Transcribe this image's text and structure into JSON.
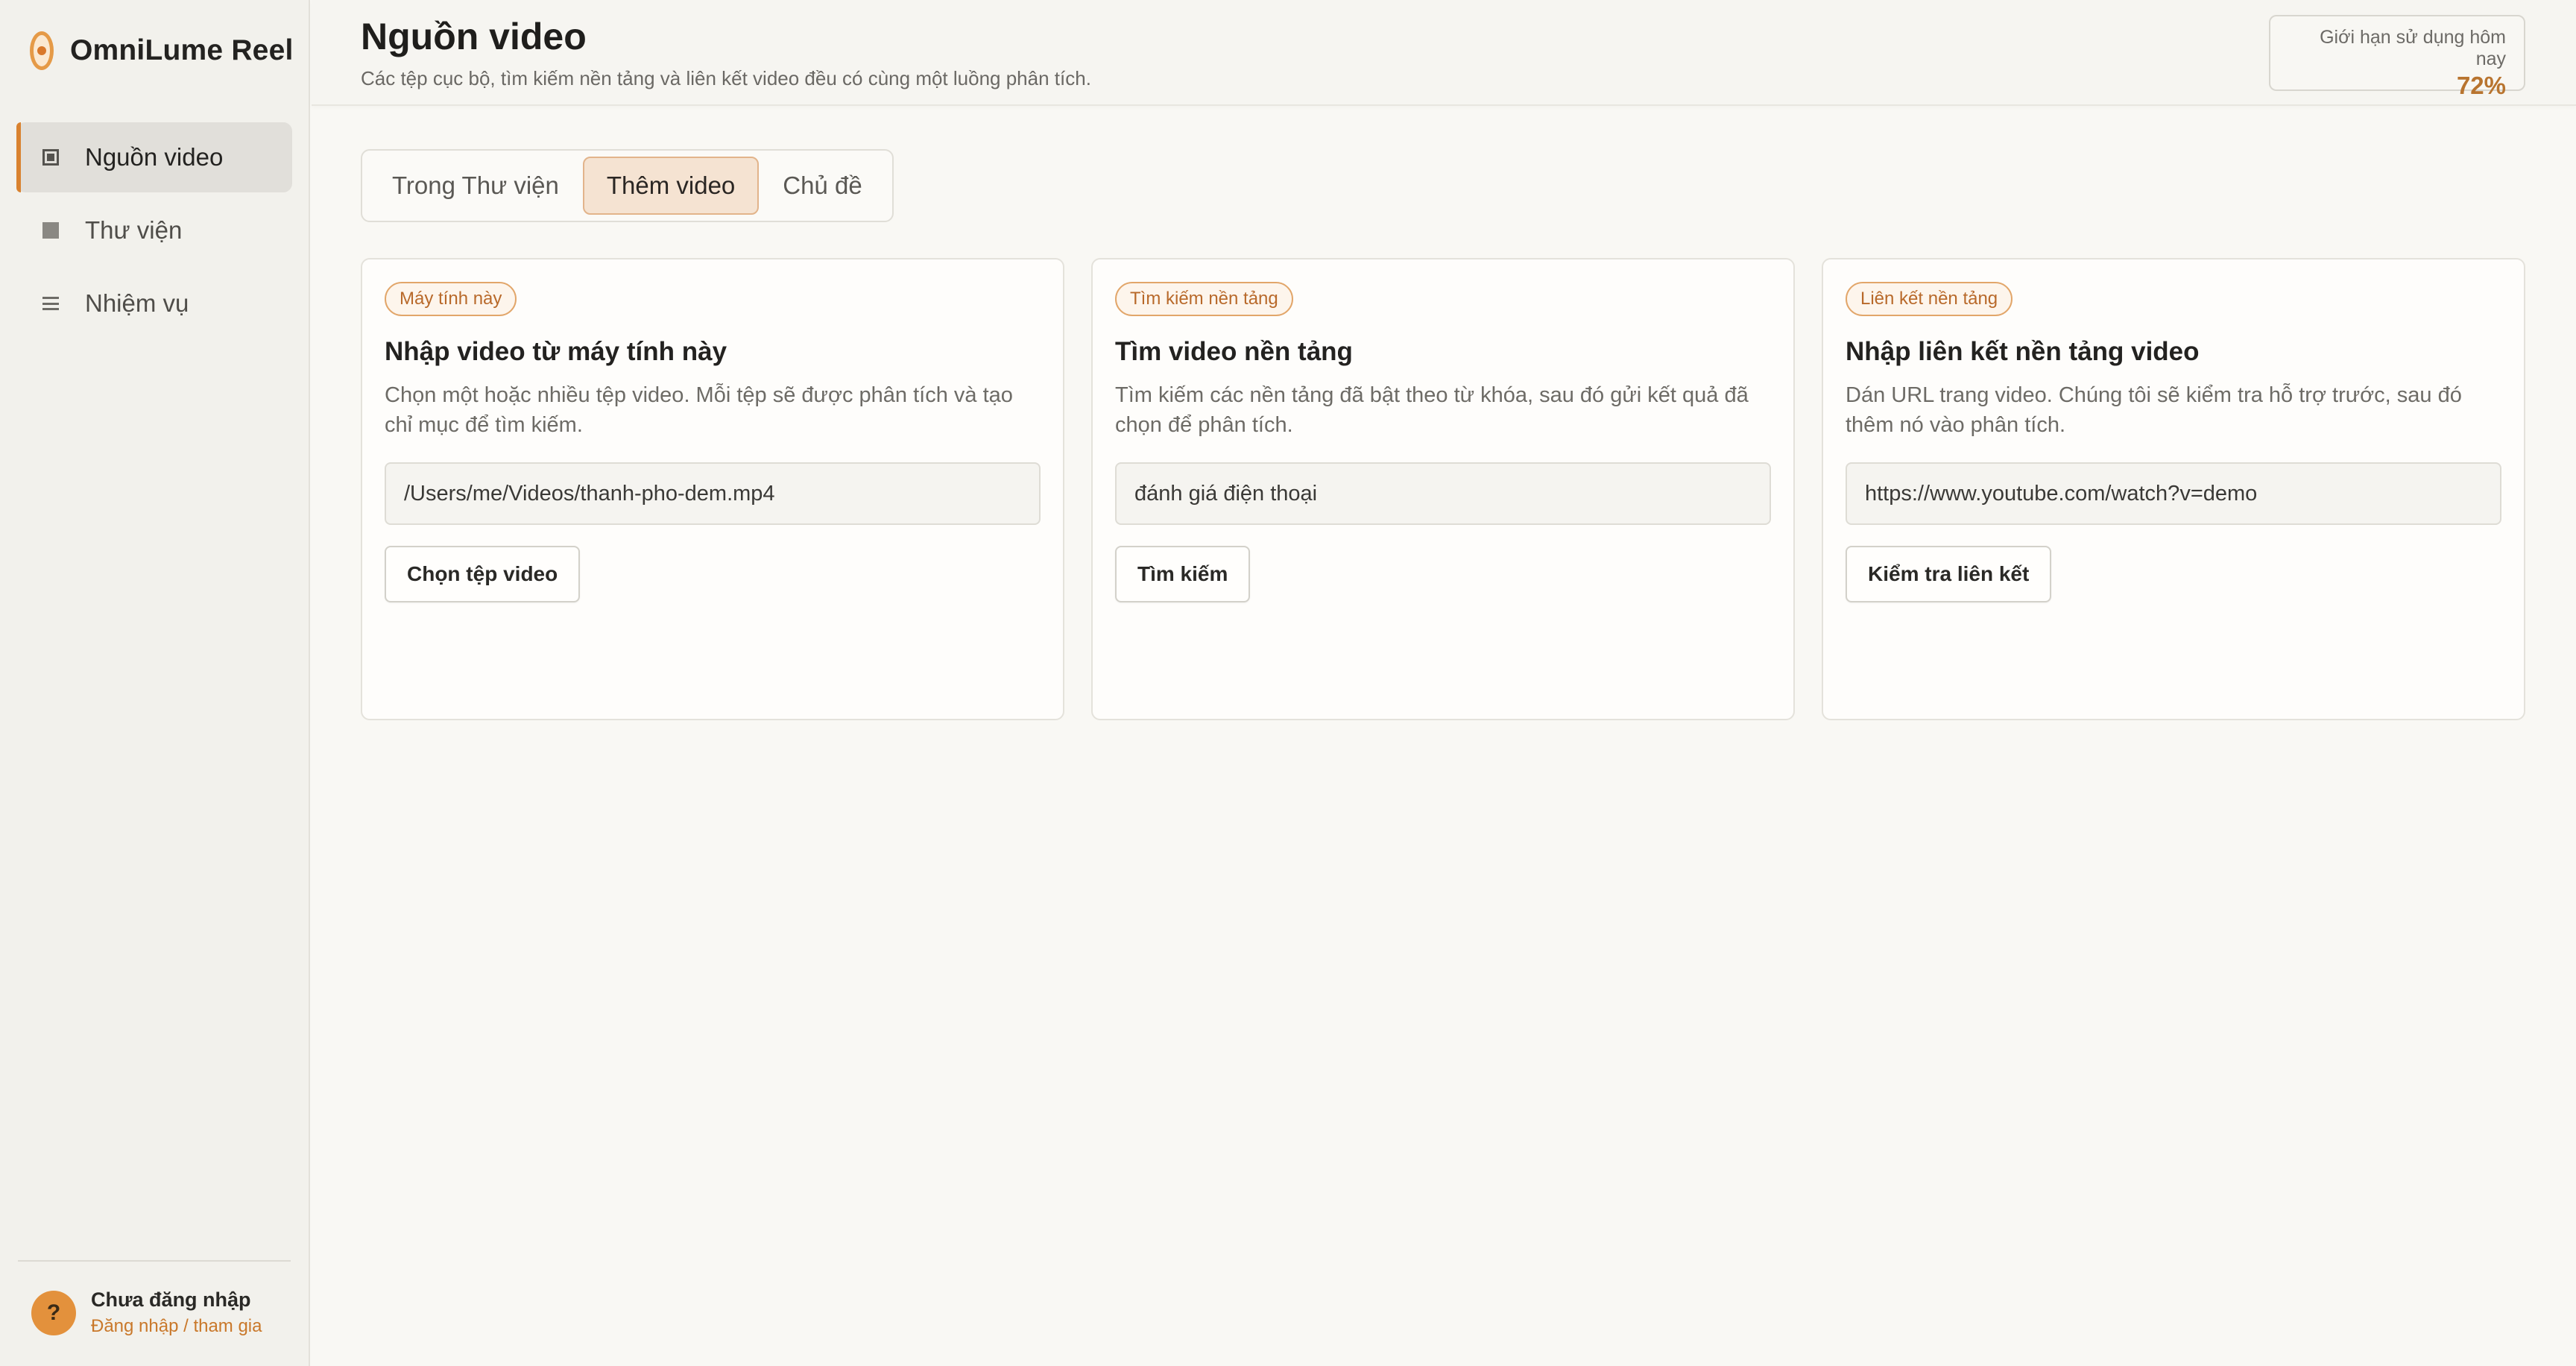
{
  "app": {
    "name": "OmniLume Reel",
    "accent_color": "#d9822f"
  },
  "sidebar": {
    "items": [
      {
        "label": "Nguồn video",
        "icon": "source-icon",
        "active": true
      },
      {
        "label": "Thư viện",
        "icon": "library-icon",
        "active": false
      },
      {
        "label": "Nhiệm vụ",
        "icon": "tasks-icon",
        "active": false
      }
    ],
    "account": {
      "avatar_glyph": "?",
      "title": "Chưa đăng nhập",
      "link": "Đăng nhập / tham gia"
    }
  },
  "header": {
    "title": "Nguồn video",
    "subtitle": "Các tệp cục bộ, tìm kiếm nền tảng và liên kết video đều có cùng một luồng phân tích.",
    "usage_label": "Giới hạn sử dụng hôm nay",
    "usage_value": "72%"
  },
  "tabs": [
    {
      "label": "Trong Thư viện",
      "active": false
    },
    {
      "label": "Thêm video",
      "active": true
    },
    {
      "label": "Chủ đề",
      "active": false
    }
  ],
  "cards": [
    {
      "badge": "Máy tính này",
      "title": "Nhập video từ máy tính này",
      "description": "Chọn một hoặc nhiều tệp video. Mỗi tệp sẽ được phân tích và tạo chỉ mục để tìm kiếm.",
      "input_value": "/Users/me/Videos/thanh-pho-dem.mp4",
      "button": "Chọn tệp video"
    },
    {
      "badge": "Tìm kiếm nền tảng",
      "title": "Tìm video nền tảng",
      "description": "Tìm kiếm các nền tảng đã bật theo từ khóa, sau đó gửi kết quả đã chọn để phân tích.",
      "input_value": "đánh giá điện thoại",
      "button": "Tìm kiếm"
    },
    {
      "badge": "Liên kết nền tảng",
      "title": "Nhập liên kết nền tảng video",
      "description": "Dán URL trang video. Chúng tôi sẽ kiểm tra hỗ trợ trước, sau đó thêm nó vào phân tích.",
      "input_value": "https://www.youtube.com/watch?v=demo",
      "button": "Kiểm tra liên kết"
    }
  ]
}
